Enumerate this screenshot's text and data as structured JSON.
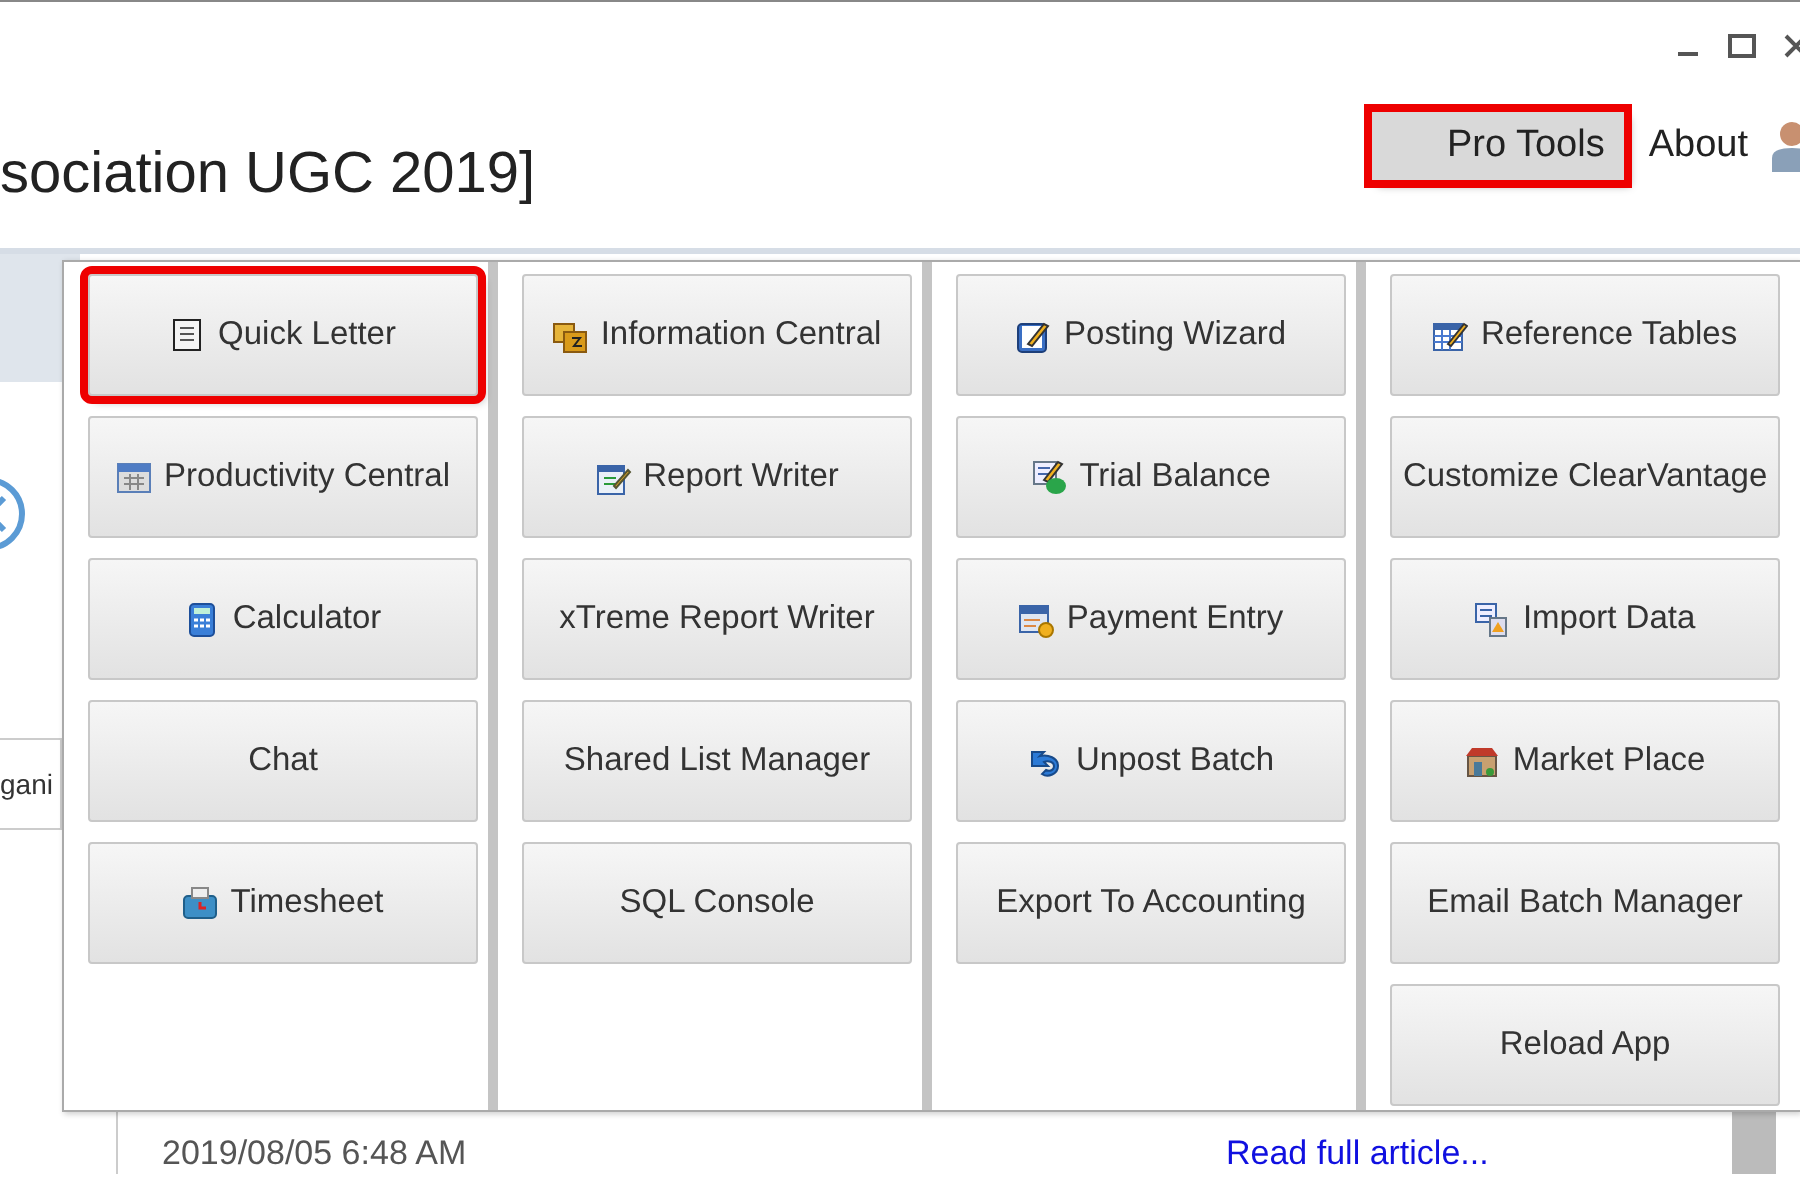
{
  "window": {
    "title": "sociation UGC 2019]"
  },
  "top_menu": [
    {
      "label": "Pro Tools",
      "highlighted": true
    },
    {
      "label": "About",
      "highlighted": false
    }
  ],
  "background": {
    "field_text": "gani",
    "timestamp": "2019/08/05 6:48 AM",
    "link": "Read full article..."
  },
  "pro_tools_menu": {
    "columns": [
      [
        {
          "label": "Quick Letter",
          "icon": true,
          "highlighted": true
        },
        {
          "label": "Productivity Central",
          "icon": true,
          "highlighted": false
        },
        {
          "label": "Calculator",
          "icon": true,
          "highlighted": false
        },
        {
          "label": "Chat",
          "icon": false,
          "highlighted": false
        },
        {
          "label": "Timesheet",
          "icon": true,
          "highlighted": false
        }
      ],
      [
        {
          "label": "Information Central",
          "icon": true,
          "highlighted": false
        },
        {
          "label": "Report Writer",
          "icon": true,
          "highlighted": false
        },
        {
          "label": "xTreme Report Writer",
          "icon": false,
          "highlighted": false
        },
        {
          "label": "Shared List Manager",
          "icon": false,
          "highlighted": false
        },
        {
          "label": "SQL Console",
          "icon": false,
          "highlighted": false
        }
      ],
      [
        {
          "label": "Posting Wizard",
          "icon": true,
          "highlighted": false
        },
        {
          "label": "Trial Balance",
          "icon": true,
          "highlighted": false
        },
        {
          "label": "Payment Entry",
          "icon": true,
          "highlighted": false
        },
        {
          "label": "Unpost Batch",
          "icon": true,
          "highlighted": false
        },
        {
          "label": "Export To Accounting",
          "icon": false,
          "highlighted": false
        }
      ],
      [
        {
          "label": "Reference Tables",
          "icon": true,
          "highlighted": false
        },
        {
          "label": "Customize ClearVantage",
          "icon": false,
          "highlighted": false
        },
        {
          "label": "Import Data",
          "icon": true,
          "highlighted": false
        },
        {
          "label": "Market Place",
          "icon": true,
          "highlighted": false
        },
        {
          "label": "Email Batch Manager",
          "icon": false,
          "highlighted": false
        },
        {
          "label": "Reload App",
          "icon": false,
          "highlighted": false
        }
      ]
    ]
  }
}
